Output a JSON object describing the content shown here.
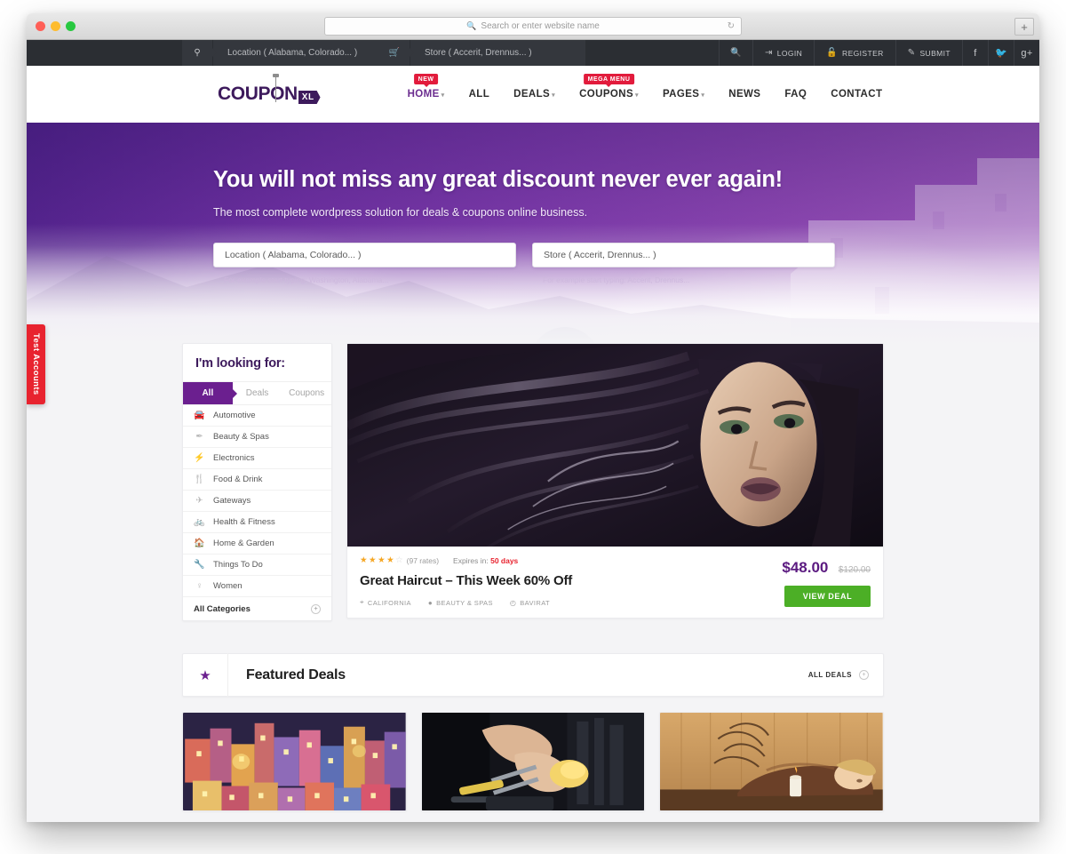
{
  "browser": {
    "url_placeholder": "Search or enter website name",
    "search_icon": "search-icon",
    "reload_icon": "reload-icon",
    "newtab_label": "+"
  },
  "topbar": {
    "location_icon": "map-pin-icon",
    "location_value": "Location ( Alabama, Colorado... )",
    "store_icon": "cart-icon",
    "store_value": "Store ( Accerit, Drennus... )",
    "search_icon": "search-icon",
    "login_label": "LOGIN",
    "register_label": "REGISTER",
    "submit_label": "SUBMIT",
    "social": [
      "f",
      "t",
      "g+"
    ]
  },
  "header": {
    "logo_text": "COUPON",
    "logo_tag": "XL",
    "nav": [
      {
        "label": "HOME",
        "caret": true,
        "active": true,
        "badge": "NEW"
      },
      {
        "label": "ALL",
        "caret": false,
        "active": false,
        "badge": ""
      },
      {
        "label": "DEALS",
        "caret": true,
        "active": false,
        "badge": ""
      },
      {
        "label": "COUPONS",
        "caret": true,
        "active": false,
        "badge": "MEGA MENU"
      },
      {
        "label": "PAGES",
        "caret": true,
        "active": false,
        "badge": ""
      },
      {
        "label": "NEWS",
        "caret": false,
        "active": false,
        "badge": ""
      },
      {
        "label": "FAQ",
        "caret": false,
        "active": false,
        "badge": ""
      },
      {
        "label": "CONTACT",
        "caret": false,
        "active": false,
        "badge": ""
      }
    ]
  },
  "hero": {
    "title": "You will not miss any great discount never ever again!",
    "subtitle": "The most complete wordpress solution for deals & coupons online business.",
    "location_value": "Location ( Alabama, Colorado... )",
    "location_hint": "For example start typing: Washington, Alabama...",
    "store_value": "Store ( Accerit, Drennus... )",
    "store_hint": "For example start typing: Accerit, Drennus..."
  },
  "test_tab": {
    "label": "Test Accounts"
  },
  "sidebar": {
    "title": "I'm looking for:",
    "tabs": [
      {
        "label": "All",
        "active": true
      },
      {
        "label": "Deals",
        "active": false
      },
      {
        "label": "Coupons",
        "active": false
      }
    ],
    "categories": [
      {
        "label": "Automotive",
        "icon": "car-icon",
        "glyph": "🚘"
      },
      {
        "label": "Beauty & Spas",
        "icon": "brush-icon",
        "glyph": "✒"
      },
      {
        "label": "Electronics",
        "icon": "plug-icon",
        "glyph": "⚡"
      },
      {
        "label": "Food & Drink",
        "icon": "cutlery-icon",
        "glyph": "🍴"
      },
      {
        "label": "Gateways",
        "icon": "plane-icon",
        "glyph": "✈"
      },
      {
        "label": "Health & Fitness",
        "icon": "bicycle-icon",
        "glyph": "🚲"
      },
      {
        "label": "Home & Garden",
        "icon": "home-icon",
        "glyph": "🏠"
      },
      {
        "label": "Things To Do",
        "icon": "wrench-icon",
        "glyph": "🔧"
      },
      {
        "label": "Women",
        "icon": "female-icon",
        "glyph": "♀"
      }
    ],
    "all_categories_label": "All Categories",
    "all_categories_icon": "circle-plus-icon"
  },
  "featured_deal": {
    "photo_alt": "woman-with-flowing-hair-photo",
    "rating_filled": 4,
    "rating_total": 5,
    "rates_label": "(97 rates)",
    "expires_prefix": "Expires in:",
    "expires_value": "50 days",
    "title": "Great Haircut – This Week 60% Off",
    "tags": [
      {
        "label": "CALIFORNIA",
        "icon": "map-pin-icon"
      },
      {
        "label": "BEAUTY & SPAS",
        "icon": "category-icon"
      },
      {
        "label": "BAVIRAT",
        "icon": "clock-icon"
      }
    ],
    "price_now": "$48.00",
    "price_old": "$120.00",
    "cta_label": "VIEW DEAL"
  },
  "featured_section": {
    "star_icon": "star-icon",
    "title": "Featured Deals",
    "all_deals_label": "ALL DEALS",
    "all_deals_icon": "circle-plus-icon",
    "cards": [
      {
        "alt": "colorful-cliffside-village-photo"
      },
      {
        "alt": "car-mechanic-repair-photo"
      },
      {
        "alt": "spa-massage-photo"
      }
    ]
  },
  "colors": {
    "brand_purple": "#6b1f8f",
    "deep_purple": "#3d1a5c",
    "accent_red": "#e8232f",
    "cta_green": "#4caf26",
    "dark_bar": "#2b2e33"
  }
}
